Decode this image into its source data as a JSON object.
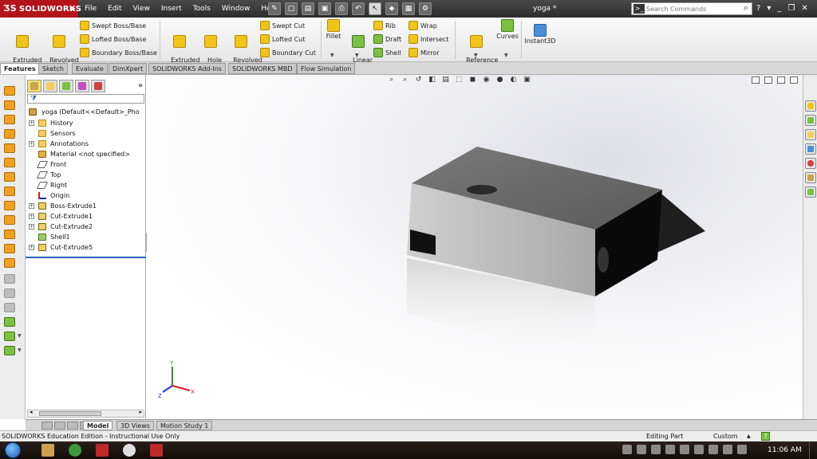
{
  "app": {
    "logo_text": "SOLIDWORKS",
    "doc_title": "yoga *",
    "accent": "#b3131b"
  },
  "menu": {
    "items": [
      "File",
      "Edit",
      "View",
      "Insert",
      "Tools",
      "Window",
      "Help"
    ]
  },
  "search": {
    "placeholder": "Search Commands"
  },
  "commands": {
    "extruded_boss": "Extruded\nBoss/Base",
    "revolved_boss": "Revolved\nBoss/Base",
    "swept_boss": "Swept Boss/Base",
    "lofted_boss": "Lofted Boss/Base",
    "boundary_boss": "Boundary Boss/Base",
    "extruded_cut": "Extruded\nCut",
    "hole_wizard": "Hole\nWizard",
    "revolved_cut": "Revolved\nCut",
    "swept_cut": "Swept Cut",
    "lofted_cut": "Lofted Cut",
    "boundary_cut": "Boundary Cut",
    "fillet": "Fillet",
    "linear_pattern": "Linear\nPattern",
    "rib": "Rib",
    "draft": "Draft",
    "shell": "Shell",
    "wrap": "Wrap",
    "intersect": "Intersect",
    "mirror": "Mirror",
    "reference_geometry": "Reference\nGeometry",
    "curves": "Curves",
    "instant3d": "Instant3D"
  },
  "tabs": [
    "Features",
    "Sketch",
    "Evaluate",
    "DimXpert",
    "SOLIDWORKS Add-Ins",
    "SOLIDWORKS MBD",
    "Flow Simulation"
  ],
  "tree": {
    "root": "yoga  (Default<<Default>_Pho",
    "items": [
      {
        "label": "History",
        "icon": "folder-icon",
        "expand": true
      },
      {
        "label": "Sensors",
        "icon": "folder-icon",
        "expand": false
      },
      {
        "label": "Annotations",
        "icon": "annotation-icon",
        "expand": true
      },
      {
        "label": "Material <not specified>",
        "icon": "material-icon",
        "expand": false
      },
      {
        "label": "Front",
        "icon": "plane-icon",
        "expand": false
      },
      {
        "label": "Top",
        "icon": "plane-icon",
        "expand": false
      },
      {
        "label": "Right",
        "icon": "plane-icon",
        "expand": false
      },
      {
        "label": "Origin",
        "icon": "origin-icon",
        "expand": false
      },
      {
        "label": "Boss-Extrude1",
        "icon": "extrude-icon",
        "expand": true
      },
      {
        "label": "Cut-Extrude1",
        "icon": "cut-icon",
        "expand": true
      },
      {
        "label": "Cut-Extrude2",
        "icon": "cut-icon",
        "expand": true
      },
      {
        "label": "Shell1",
        "icon": "shell-icon",
        "expand": false
      },
      {
        "label": "Cut-Extrude5",
        "icon": "cut-icon",
        "expand": true
      }
    ]
  },
  "viewtabs": [
    "Model",
    "3D Views",
    "Motion Study 1"
  ],
  "status": {
    "edition": "SOLIDWORKS Education Edition - Instructional Use Only",
    "mode": "Editing Part",
    "units": "Custom",
    "help": "?"
  },
  "triad": {
    "x": "X",
    "y": "Y",
    "z": "Z"
  },
  "taskbar": {
    "clock": "11:06 AM"
  }
}
